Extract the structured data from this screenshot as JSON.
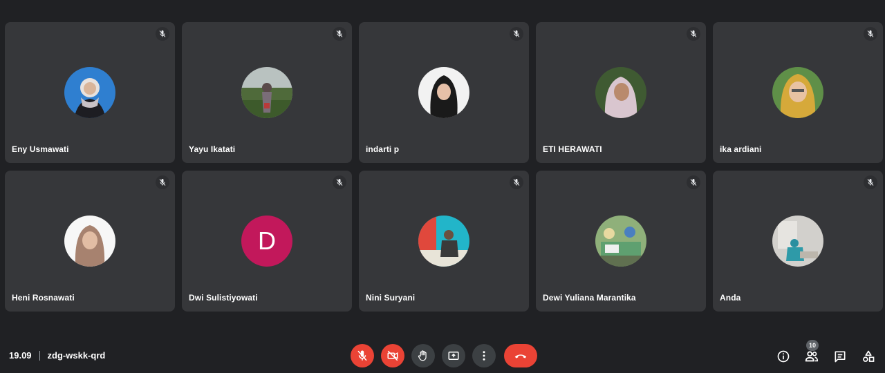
{
  "participants": [
    {
      "name": "Eny Usmawati",
      "avatar": "photo",
      "muted": true
    },
    {
      "name": "Yayu Ikatati",
      "avatar": "photo",
      "muted": true
    },
    {
      "name": "indarti p",
      "avatar": "photo",
      "muted": true
    },
    {
      "name": "ETI HERAWATI",
      "avatar": "photo",
      "muted": true
    },
    {
      "name": "ika ardiani",
      "avatar": "photo",
      "muted": true
    },
    {
      "name": "Heni Rosnawati",
      "avatar": "photo",
      "muted": true
    },
    {
      "name": "Dwi Sulistiyowati",
      "avatar": "letter",
      "letter": "D",
      "muted": true
    },
    {
      "name": "Nini Suryani",
      "avatar": "photo",
      "muted": true
    },
    {
      "name": "Dewi Yuliana Marantika",
      "avatar": "photo",
      "muted": true
    },
    {
      "name": "Anda",
      "avatar": "photo",
      "muted": true
    }
  ],
  "meeting": {
    "time": "19.09",
    "code": "zdg-wskk-qrd"
  },
  "people_count": "10",
  "controls": [
    "mic-off-icon",
    "camera-off-icon",
    "raise-hand-icon",
    "present-screen-icon",
    "more-options-icon",
    "end-call-icon"
  ],
  "right_controls": [
    "info-icon",
    "people-icon",
    "chat-icon",
    "activities-icon"
  ],
  "colors": {
    "background": "#202124",
    "tile": "#36373a",
    "end_call": "#ea4335",
    "letter_avatar": "#c2185b"
  }
}
